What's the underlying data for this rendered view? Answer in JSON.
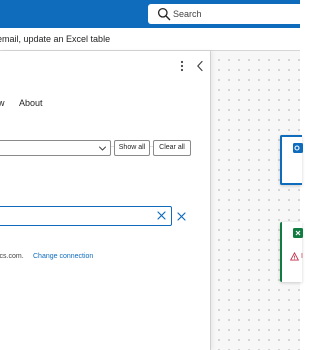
{
  "topbar": {
    "search_placeholder": "Search"
  },
  "flow": {
    "title": "email, update an Excel table"
  },
  "panel": {
    "more_icon": "more-vertical-icon",
    "collapse_icon": "chevron-left-icon",
    "tabs": [
      {
        "label": "w"
      },
      {
        "label": "About"
      }
    ],
    "filter": {
      "selected_value": "",
      "show_all_label": "Show all",
      "clear_all_label": "Clear all"
    },
    "search": {
      "value": ""
    },
    "connection": {
      "account_text": "ics.com.",
      "change_label": "Change connection"
    }
  },
  "canvas": {
    "nodes": [
      {
        "name": "outlook-step",
        "accent": "#0f6cbd"
      },
      {
        "name": "excel-step",
        "accent": "#107c41",
        "status_text": "I"
      }
    ]
  },
  "colors": {
    "brand": "#0f6cbd",
    "excel": "#107c41",
    "error": "#c4314b"
  }
}
